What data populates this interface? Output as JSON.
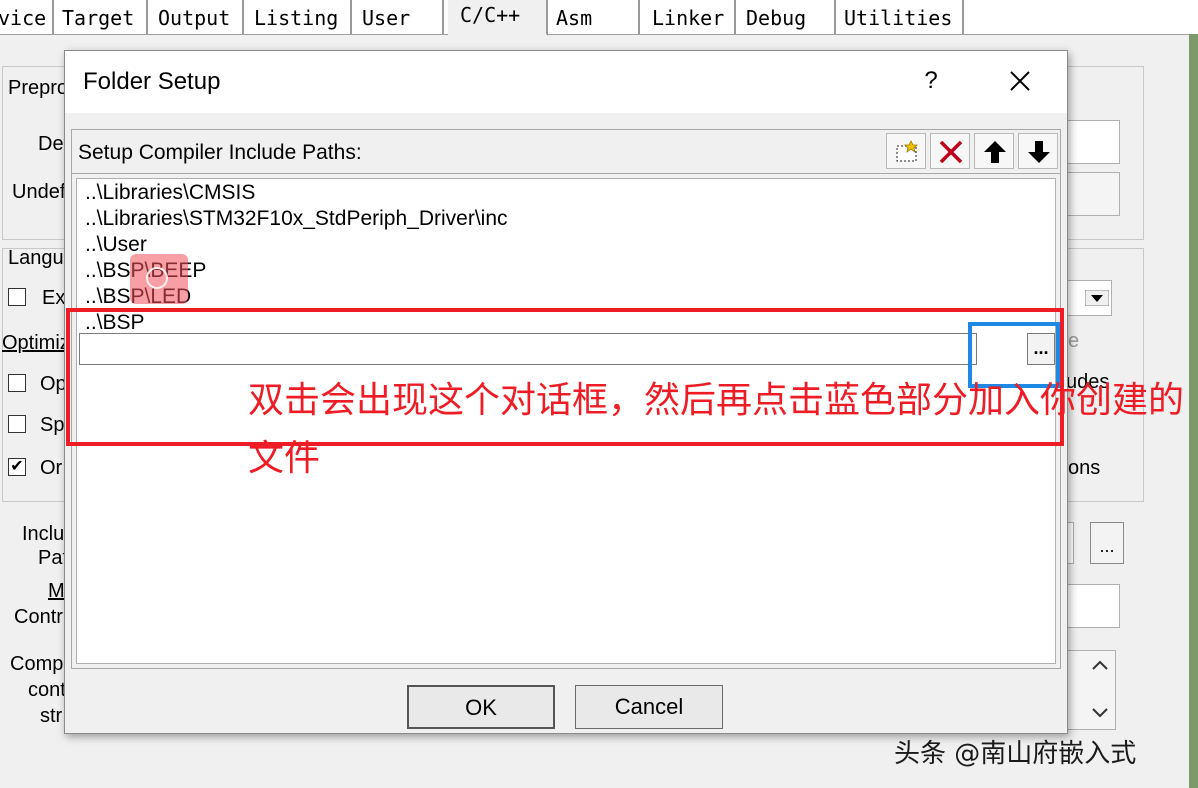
{
  "background": {
    "tabs": [
      {
        "label": "vice",
        "active": false
      },
      {
        "label": "Target",
        "active": false
      },
      {
        "label": "Output",
        "active": false
      },
      {
        "label": "Listing",
        "active": false
      },
      {
        "label": "User",
        "active": false
      },
      {
        "label": "C/C++",
        "active": true
      },
      {
        "label": "Asm",
        "active": false
      },
      {
        "label": "Linker",
        "active": false
      },
      {
        "label": "Debug",
        "active": false
      },
      {
        "label": "Utilities",
        "active": false
      }
    ],
    "left_labels": {
      "preprocessor": "Prepro",
      "define": "Def",
      "undefine": "Undef",
      "language": "Langu",
      "execute": "Ex",
      "optimization": "Optimiz",
      "opt1": "Op",
      "opt2": "Sp",
      "opt3": "Or",
      "include_1": "Inclu",
      "include_2": "Pat",
      "misc_1": "M",
      "misc_2": "Contr",
      "compiler_1": "Comp",
      "compiler_2": "cont",
      "compiler_3": "str"
    },
    "right_labels": {
      "e": "e",
      "includes": "udes",
      "options": "ons",
      "browse": "..."
    }
  },
  "dialog": {
    "title": "Folder Setup",
    "help_label": "?",
    "group_label": "Setup Compiler Include Paths:",
    "toolbar": {
      "new_icon": "new-folder-icon",
      "delete_icon": "delete-x-icon",
      "up_icon": "arrow-up-icon",
      "down_icon": "arrow-down-icon",
      "delete_color": "#c0001a"
    },
    "paths": [
      "..\\Libraries\\CMSIS",
      "..\\Libraries\\STM32F10x_StdPeriph_Driver\\inc",
      "..\\User",
      "..\\BSP\\BEEP",
      "..\\BSP\\LED",
      "..\\BSP"
    ],
    "edit_value": "",
    "browse_label": "...",
    "ok_label": "OK",
    "cancel_label": "Cancel"
  },
  "annotation": {
    "note": "双击会出现这个对话框，然后再点击蓝色部分加入你创建的文件",
    "red_color": "#ee1c24",
    "blue_color": "#1e88e5"
  },
  "watermark": "头条 @南山府嵌入式"
}
